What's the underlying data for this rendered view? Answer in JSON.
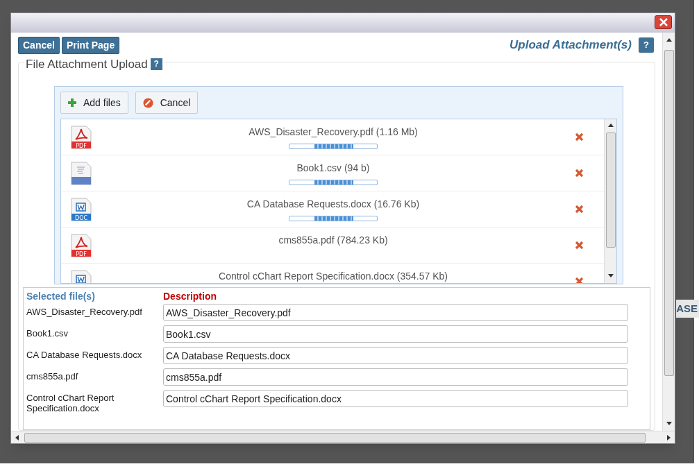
{
  "background": {
    "tab_fragment": "ASE"
  },
  "dialog": {
    "toolbar": {
      "buttons": [
        "Cancel",
        "Print Page"
      ],
      "title": "Upload Attachment(s)",
      "help": "?"
    },
    "fieldset": {
      "legend": "File Attachment Upload",
      "help": "?"
    },
    "uploader": {
      "buttons": [
        {
          "kind": "add",
          "label": "Add files"
        },
        {
          "kind": "cancel",
          "label": "Cancel"
        }
      ],
      "files": [
        {
          "kind": "pdf",
          "icon_text": "PDF",
          "label": "AWS_Disaster_Recovery.pdf (1.16 Mb)",
          "uploading": true
        },
        {
          "kind": "text",
          "label": "Book1.csv (94 b)",
          "uploading": true
        },
        {
          "kind": "doc",
          "icon_text": "DOC",
          "label": "CA Database Requests.docx (16.76 Kb)",
          "uploading": true
        },
        {
          "kind": "pdf",
          "icon_text": "PDF",
          "label": "cms855a.pdf (784.23 Kb)",
          "uploading": false
        },
        {
          "kind": "doc",
          "label": "Control cChart Report Specification.docx (354.57 Kb)",
          "uploading": false
        }
      ]
    },
    "table": {
      "columns": [
        "Selected file(s)",
        "Description"
      ],
      "rows": [
        {
          "file": "AWS_Disaster_Recovery.pdf",
          "description": "AWS_Disaster_Recovery.pdf"
        },
        {
          "file": "Book1.csv",
          "description": "Book1.csv"
        },
        {
          "file": "CA Database Requests.docx",
          "description": "CA Database Requests.docx"
        },
        {
          "file": "cms855a.pdf",
          "description": "cms855a.pdf"
        },
        {
          "file": "Control cChart Report Specification.docx",
          "description": "Control cChart Report Specification.docx"
        }
      ]
    }
  }
}
